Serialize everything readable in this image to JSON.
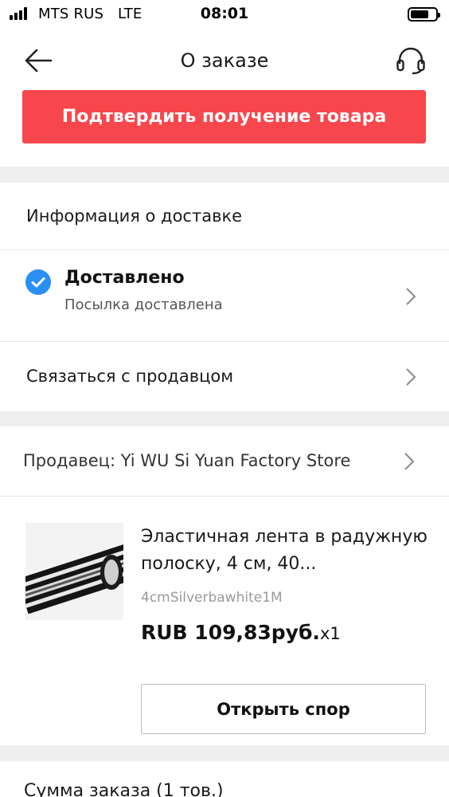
{
  "status_bar": {
    "carrier": "MTS RUS   LTE",
    "time": "08:01"
  },
  "header": {
    "title": "О заказе",
    "back_icon": "arrow-left-icon",
    "support_icon": "headset-icon"
  },
  "actions": {
    "confirm_label": "Подтвердить получение товара",
    "confirm_color": "#f7474d"
  },
  "delivery": {
    "section_title": "Информация о доставке",
    "status_title": "Доставлено",
    "status_subtitle": "Посылка доставлена",
    "status_icon": "check-circle-icon",
    "status_color": "#2a8ff5",
    "contact_seller": "Связаться с продавцом"
  },
  "seller": {
    "label": "Продавец: Yi WU Si Yuan Factory Store"
  },
  "product": {
    "title": "Эластичная лента в радужную полоску, 4 см, 40...",
    "variant": "4cmSilverbawhite1M",
    "price": "RUB 109,83руб.",
    "quantity": "x1",
    "dispute_label": "Открыть спор"
  },
  "summary": {
    "label": "Сумма заказа (1 тов.)"
  }
}
